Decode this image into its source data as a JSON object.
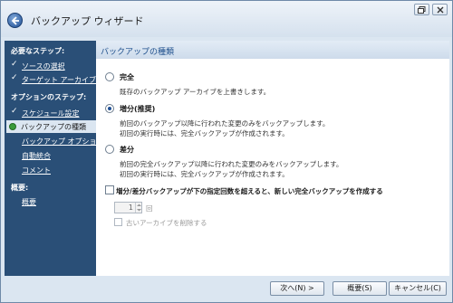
{
  "window": {
    "title": "バックアップ ウィザード"
  },
  "sidebar": {
    "required_header": "必要なステップ:",
    "required_items": [
      {
        "label": "ソースの選択"
      },
      {
        "label": "ターゲット アーカイブ"
      }
    ],
    "optional_header": "オプションのステップ:",
    "optional_items": [
      {
        "label": "スケジュール設定"
      },
      {
        "label": "バックアップの種類"
      },
      {
        "label": "バックアップ オプション"
      },
      {
        "label": "自動統合"
      },
      {
        "label": "コメント"
      }
    ],
    "summary_header": "概要:",
    "summary_item": "概要"
  },
  "content": {
    "title": "バックアップの種類",
    "options": [
      {
        "label": "完全",
        "selected": false,
        "desc": [
          "既存のバックアップ アーカイブを上書きします。"
        ]
      },
      {
        "label": "増分(推奨)",
        "selected": true,
        "desc": [
          "前回のバックアップ以降に行われた変更のみをバックアップします。",
          "初回の実行時には、完全バックアップが作成されます。"
        ]
      },
      {
        "label": "差分",
        "selected": false,
        "desc": [
          "前回の完全バックアップ以降に行われた変更のみをバックアップします。",
          "初回の実行時には、完全バックアップが作成されます。"
        ]
      }
    ],
    "checkbox_label": "増分/差分バックアップが下の指定回数を超えると、新しい完全バックアップを作成する",
    "spin_value": "1",
    "spin_unit": "回",
    "delete_old_label": "古いアーカイブを削除する"
  },
  "buttons": {
    "next": "次へ(N) >",
    "summary": "概要(S)",
    "cancel": "キャンセル(C)"
  }
}
